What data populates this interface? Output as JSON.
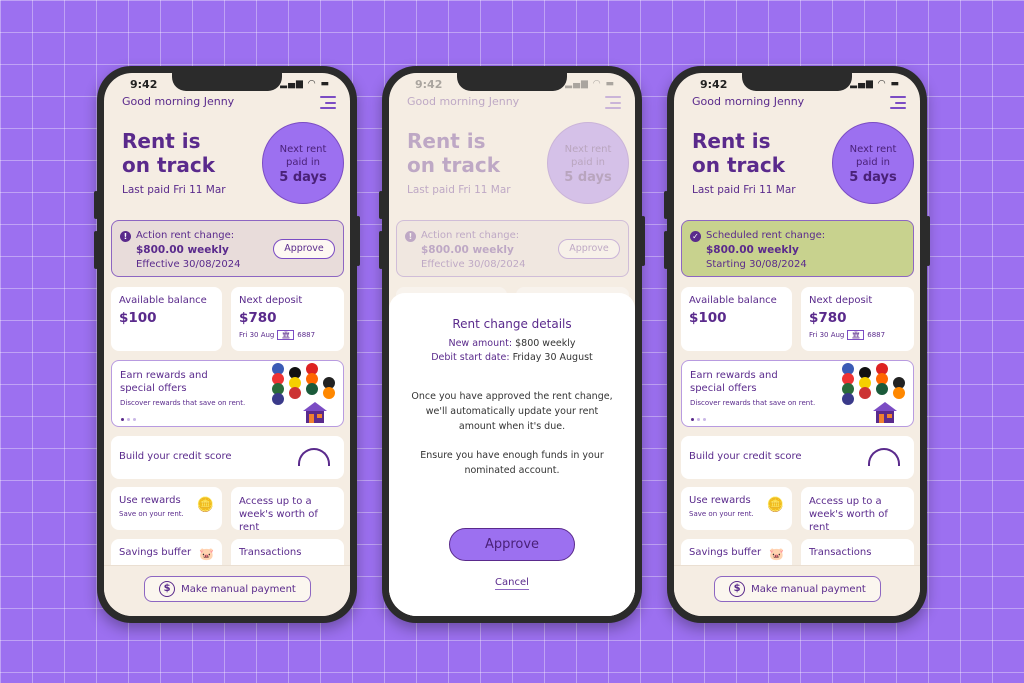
{
  "colors": {
    "background": "#9c70f0",
    "accent": "#5a2a8c",
    "circle": "#9c70f0",
    "scheduled": "#c8d28e",
    "action": "#e8dcda"
  },
  "phones": [
    {
      "time": "9:42",
      "greeting": "Good morning Jenny",
      "title_line1": "Rent is",
      "title_line2": "on track",
      "last_paid": "Last paid Fri 11 Mar",
      "circle": {
        "line1": "Next rent",
        "line2": "paid in",
        "days": "5 days"
      },
      "alert": {
        "icon": "exclamation-icon",
        "label": "Action rent change:",
        "amount": "$800.00 weekly",
        "date": "Effective 30/08/2024",
        "button": "Approve"
      },
      "balance": {
        "label": "Available balance",
        "value": "$100"
      },
      "deposit": {
        "label": "Next deposit",
        "value": "$780",
        "date": "Fri 30 Aug",
        "account": "6887"
      },
      "rewards": {
        "title": "Earn rewards and special offers",
        "subtitle": "Discover rewards that save on rent."
      },
      "credit": "Build your credit score",
      "use_rewards": {
        "title": "Use rewards",
        "subtitle": "Save on your rent."
      },
      "access": "Access up to a week's worth of rent",
      "savings": "Savings buffer",
      "transactions": "Transactions",
      "manual_payment": "Make manual payment"
    },
    {
      "time": "9:42",
      "greeting": "Good morning Jenny",
      "title_line1": "Rent is",
      "title_line2": "on track",
      "last_paid": "Last paid Fri 11 Mar",
      "circle": {
        "line1": "Next rent",
        "line2": "paid in",
        "days": "5 days"
      },
      "alert": {
        "icon": "exclamation-icon",
        "label": "Action rent change:",
        "amount": "$800.00 weekly",
        "date": "Effective 30/08/2024",
        "button": "Approve"
      },
      "modal": {
        "title": "Rent change details",
        "amount_label": "New amount:",
        "amount_value": "$800 weekly",
        "date_label": "Debit start date:",
        "date_value": "Friday 30 August",
        "body1": "Once you have approved the rent change, we'll automatically update your rent amount when it's due.",
        "body2": "Ensure you have enough funds in your nominated account.",
        "approve": "Approve",
        "cancel": "Cancel"
      }
    },
    {
      "time": "9:42",
      "greeting": "Good morning Jenny",
      "title_line1": "Rent is",
      "title_line2": "on track",
      "last_paid": "Last paid Fri 11 Mar",
      "circle": {
        "line1": "Next rent",
        "line2": "paid in",
        "days": "5 days"
      },
      "alert": {
        "icon": "check-circle-icon",
        "label": "Scheduled rent change:",
        "amount": "$800.00 weekly",
        "date": "Starting 30/08/2024"
      },
      "balance": {
        "label": "Available balance",
        "value": "$100"
      },
      "deposit": {
        "label": "Next deposit",
        "value": "$780",
        "date": "Fri 30 Aug",
        "account": "6887"
      },
      "rewards": {
        "title": "Earn rewards and special offers",
        "subtitle": "Discover rewards that save on rent."
      },
      "credit": "Build your credit score",
      "use_rewards": {
        "title": "Use rewards",
        "subtitle": "Save on your rent."
      },
      "access": "Access up to a week's worth of rent",
      "savings": "Savings buffer",
      "transactions": "Transactions",
      "manual_payment": "Make manual payment"
    }
  ]
}
